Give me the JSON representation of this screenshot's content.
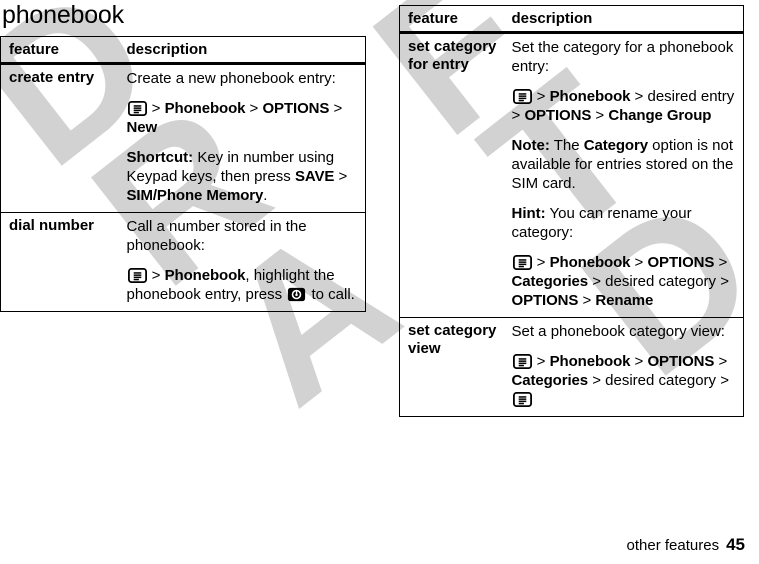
{
  "page": {
    "title": "phonebook",
    "footer_section": "other features",
    "footer_page_number": "45",
    "watermark_text": "DRAFT"
  },
  "icons": {
    "menu": "menu-key-icon",
    "call": "call-send-key-icon"
  },
  "left_table": {
    "headers": {
      "feature": "feature",
      "description": "description"
    },
    "rows": [
      {
        "feature": "create entry",
        "blocks": [
          {
            "id": "create-entry-intro",
            "parts": [
              {
                "t": "text",
                "v": "Create a new phonebook entry:"
              }
            ]
          },
          {
            "id": "create-entry-path",
            "parts": [
              {
                "t": "icon",
                "v": "menu"
              },
              {
                "t": "sep",
                "v": " > "
              },
              {
                "t": "ui",
                "v": "Phonebook"
              },
              {
                "t": "sep",
                "v": " > "
              },
              {
                "t": "ui",
                "v": "OPTIONS"
              },
              {
                "t": "sep",
                "v": " > "
              },
              {
                "t": "ui",
                "v": "New"
              }
            ]
          },
          {
            "id": "create-entry-shortcut",
            "parts": [
              {
                "t": "lbl",
                "v": "Shortcut:"
              },
              {
                "t": "text",
                "v": " Key in number using Keypad keys, then press "
              },
              {
                "t": "ui",
                "v": "SAVE"
              },
              {
                "t": "sep",
                "v": " > "
              },
              {
                "t": "ui",
                "v": "SIM/Phone Memory"
              },
              {
                "t": "text",
                "v": "."
              }
            ]
          }
        ]
      },
      {
        "feature": "dial number",
        "blocks": [
          {
            "id": "dial-number-intro",
            "parts": [
              {
                "t": "text",
                "v": "Call a number stored in the phonebook:"
              }
            ]
          },
          {
            "id": "dial-number-path",
            "parts": [
              {
                "t": "icon",
                "v": "menu"
              },
              {
                "t": "sep",
                "v": " > "
              },
              {
                "t": "ui",
                "v": "Phonebook"
              },
              {
                "t": "text",
                "v": ", highlight the phonebook entry, press "
              },
              {
                "t": "icon",
                "v": "call"
              },
              {
                "t": "text",
                "v": " to call."
              }
            ]
          }
        ]
      }
    ]
  },
  "right_table": {
    "headers": {
      "feature": "feature",
      "description": "description"
    },
    "rows": [
      {
        "feature": "set category for entry",
        "blocks": [
          {
            "id": "set-category-entry-intro",
            "parts": [
              {
                "t": "text",
                "v": "Set the category for a phonebook entry:"
              }
            ]
          },
          {
            "id": "set-category-entry-path",
            "parts": [
              {
                "t": "icon",
                "v": "menu"
              },
              {
                "t": "sep",
                "v": " > "
              },
              {
                "t": "ui",
                "v": "Phonebook"
              },
              {
                "t": "sep",
                "v": " > "
              },
              {
                "t": "text",
                "v": "desired entry"
              },
              {
                "t": "sep",
                "v": " > "
              },
              {
                "t": "ui",
                "v": "OPTIONS"
              },
              {
                "t": "sep",
                "v": " > "
              },
              {
                "t": "ui",
                "v": "Change Group"
              }
            ]
          },
          {
            "id": "set-category-entry-note",
            "parts": [
              {
                "t": "lbl",
                "v": "Note:"
              },
              {
                "t": "text",
                "v": " The "
              },
              {
                "t": "ui",
                "v": "Category"
              },
              {
                "t": "text",
                "v": " option is not available for entries stored on the SIM card."
              }
            ]
          },
          {
            "id": "set-category-entry-hint",
            "parts": [
              {
                "t": "lbl",
                "v": "Hint:"
              },
              {
                "t": "text",
                "v": " You can rename your category:"
              }
            ]
          },
          {
            "id": "set-category-entry-rename-path",
            "parts": [
              {
                "t": "icon",
                "v": "menu"
              },
              {
                "t": "sep",
                "v": " > "
              },
              {
                "t": "ui",
                "v": "Phonebook"
              },
              {
                "t": "sep",
                "v": " > "
              },
              {
                "t": "ui",
                "v": "OPTIONS"
              },
              {
                "t": "sep",
                "v": " > "
              },
              {
                "t": "ui",
                "v": "Categories"
              },
              {
                "t": "sep",
                "v": " > "
              },
              {
                "t": "text",
                "v": "desired category"
              },
              {
                "t": "sep",
                "v": " > "
              },
              {
                "t": "ui",
                "v": "OPTIONS"
              },
              {
                "t": "sep",
                "v": " > "
              },
              {
                "t": "ui",
                "v": "Rename"
              }
            ]
          }
        ]
      },
      {
        "feature": "set category view",
        "blocks": [
          {
            "id": "set-category-view-intro",
            "parts": [
              {
                "t": "text",
                "v": "Set a phonebook category view:"
              }
            ]
          },
          {
            "id": "set-category-view-path",
            "parts": [
              {
                "t": "icon",
                "v": "menu"
              },
              {
                "t": "sep",
                "v": " > "
              },
              {
                "t": "ui",
                "v": "Phonebook"
              },
              {
                "t": "sep",
                "v": " > "
              },
              {
                "t": "ui",
                "v": "OPTIONS"
              },
              {
                "t": "sep",
                "v": " > "
              },
              {
                "t": "ui",
                "v": "Categories"
              },
              {
                "t": "sep",
                "v": " > "
              },
              {
                "t": "text",
                "v": "desired category"
              },
              {
                "t": "sep",
                "v": " > "
              },
              {
                "t": "icon",
                "v": "menu"
              }
            ]
          }
        ]
      }
    ]
  }
}
